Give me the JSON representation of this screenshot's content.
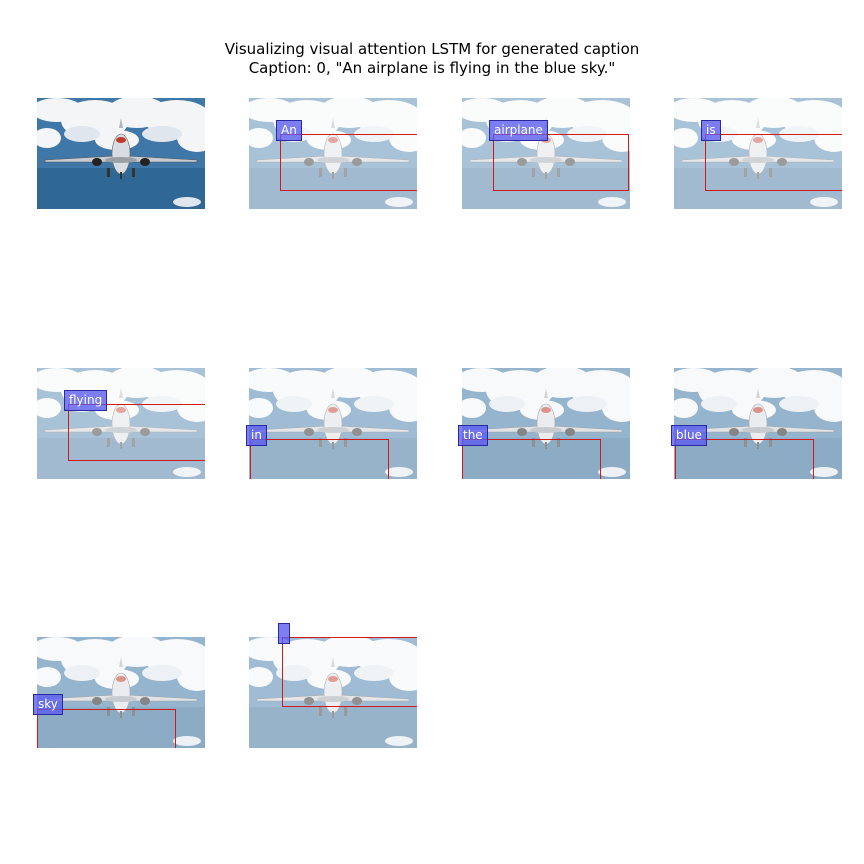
{
  "figure": {
    "title_line1": "Visualizing visual attention LSTM for generated caption",
    "title_line2": "Caption: 0, \"An airplane is flying in the blue sky.\""
  },
  "panels": [
    {
      "word": "",
      "kind": "original"
    },
    {
      "word": "An",
      "kind": "attention"
    },
    {
      "word": "airplane",
      "kind": "attention"
    },
    {
      "word": "is",
      "kind": "attention"
    },
    {
      "word": "flying",
      "kind": "attention"
    },
    {
      "word": "in",
      "kind": "attention"
    },
    {
      "word": "the",
      "kind": "attention"
    },
    {
      "word": "blue",
      "kind": "attention"
    },
    {
      "word": "sky",
      "kind": "attention"
    },
    {
      "word": "",
      "kind": "attention"
    }
  ],
  "colors": {
    "sky": "#3f78a8",
    "box_border": "#d11a1a",
    "tag_fill": "#5a5af0"
  }
}
